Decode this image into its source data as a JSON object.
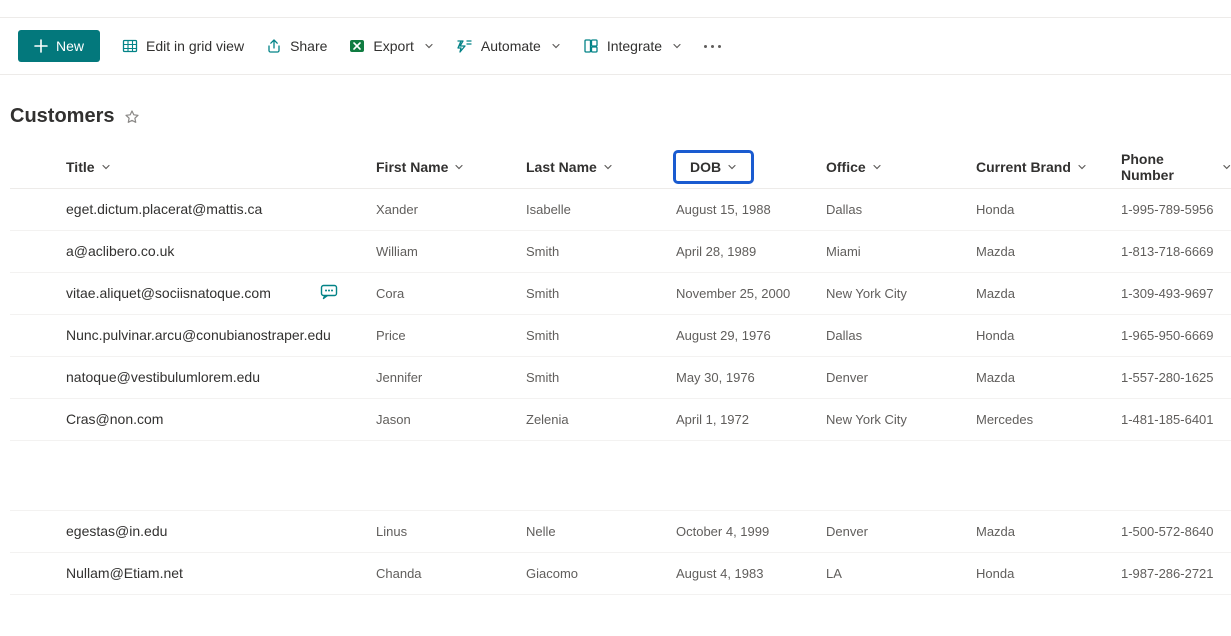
{
  "toolbar": {
    "new_label": "New",
    "edit_label": "Edit in grid view",
    "share_label": "Share",
    "export_label": "Export",
    "automate_label": "Automate",
    "integrate_label": "Integrate"
  },
  "list": {
    "title": "Customers"
  },
  "columns": {
    "title": "Title",
    "first_name": "First Name",
    "last_name": "Last Name",
    "dob": "DOB",
    "office": "Office",
    "brand": "Current Brand",
    "phone": "Phone Number"
  },
  "highlighted_column": "dob",
  "rows": [
    {
      "title": "eget.dictum.placerat@mattis.ca",
      "first": "Xander",
      "last": "Isabelle",
      "dob": "August 15, 1988",
      "office": "Dallas",
      "brand": "Honda",
      "phone": "1-995-789-5956",
      "has_comment": false
    },
    {
      "title": "a@aclibero.co.uk",
      "first": "William",
      "last": "Smith",
      "dob": "April 28, 1989",
      "office": "Miami",
      "brand": "Mazda",
      "phone": "1-813-718-6669",
      "has_comment": false
    },
    {
      "title": "vitae.aliquet@sociisnatoque.com",
      "first": "Cora",
      "last": "Smith",
      "dob": "November 25, 2000",
      "office": "New York City",
      "brand": "Mazda",
      "phone": "1-309-493-9697",
      "has_comment": true
    },
    {
      "title": "Nunc.pulvinar.arcu@conubianostraper.edu",
      "first": "Price",
      "last": "Smith",
      "dob": "August 29, 1976",
      "office": "Dallas",
      "brand": "Honda",
      "phone": "1-965-950-6669",
      "has_comment": false
    },
    {
      "title": "natoque@vestibulumlorem.edu",
      "first": "Jennifer",
      "last": "Smith",
      "dob": "May 30, 1976",
      "office": "Denver",
      "brand": "Mazda",
      "phone": "1-557-280-1625",
      "has_comment": false
    },
    {
      "title": "Cras@non.com",
      "first": "Jason",
      "last": "Zelenia",
      "dob": "April 1, 1972",
      "office": "New York City",
      "brand": "Mercedes",
      "phone": "1-481-185-6401",
      "has_comment": false
    },
    {
      "gap": true
    },
    {
      "title": "egestas@in.edu",
      "first": "Linus",
      "last": "Nelle",
      "dob": "October 4, 1999",
      "office": "Denver",
      "brand": "Mazda",
      "phone": "1-500-572-8640",
      "has_comment": false
    },
    {
      "title": "Nullam@Etiam.net",
      "first": "Chanda",
      "last": "Giacomo",
      "dob": "August 4, 1983",
      "office": "LA",
      "brand": "Honda",
      "phone": "1-987-286-2721",
      "has_comment": false
    }
  ]
}
